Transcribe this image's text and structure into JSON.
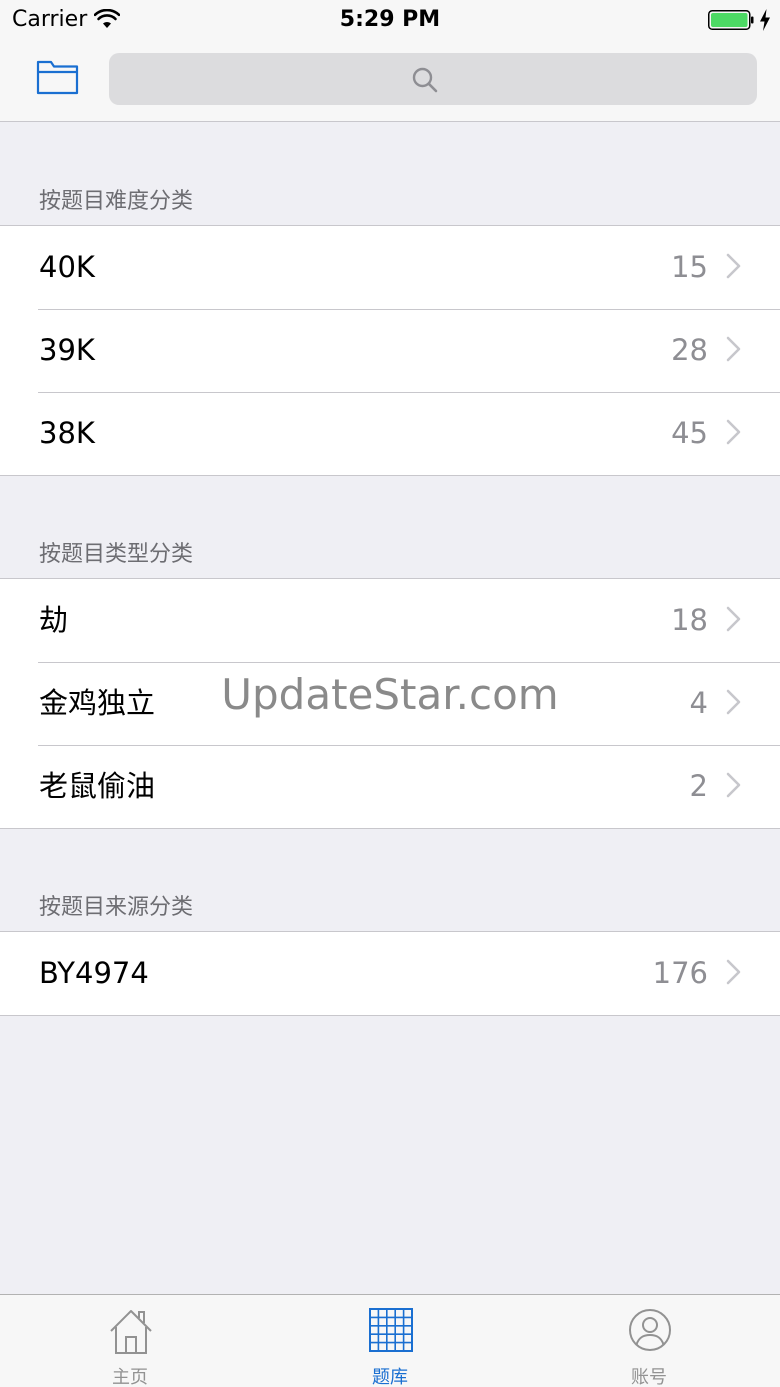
{
  "status_bar": {
    "carrier": "Carrier",
    "time": "5:29 PM"
  },
  "nav_bar": {
    "folder_icon": "folder-icon",
    "search_icon": "search-icon",
    "search_placeholder": ""
  },
  "sections": [
    {
      "header": "按题目难度分类",
      "rows": [
        {
          "title": "40K",
          "count": "15"
        },
        {
          "title": "39K",
          "count": "28"
        },
        {
          "title": "38K",
          "count": "45"
        }
      ]
    },
    {
      "header": "按题目类型分类",
      "rows": [
        {
          "title": "劫",
          "count": "18"
        },
        {
          "title": "金鸡独立",
          "count": "4"
        },
        {
          "title": "老鼠偷油",
          "count": "2"
        }
      ]
    },
    {
      "header": "按题目来源分类",
      "rows": [
        {
          "title": "BY4974",
          "count": "176"
        }
      ]
    }
  ],
  "watermark": "UpdateStar.com",
  "tab_bar": {
    "tabs": [
      {
        "label": "主页",
        "icon": "home-icon",
        "active": false
      },
      {
        "label": "题库",
        "icon": "grid-icon",
        "active": true
      },
      {
        "label": "账号",
        "icon": "account-icon",
        "active": false
      }
    ]
  },
  "colors": {
    "accent": "#1a6fd1",
    "background": "#efeff4",
    "battery": "#4cd964"
  }
}
